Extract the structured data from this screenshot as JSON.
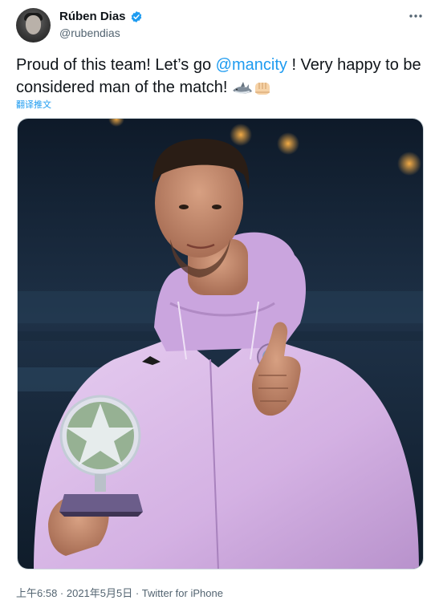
{
  "author": {
    "display_name": "Rúben Dias",
    "handle": "@rubendias",
    "verified": true
  },
  "tweet": {
    "text_part1": "Proud of this team! Let’s go ",
    "mention": "@mancity",
    "text_part2": " ! Very happy to be considered man of the match! ",
    "emojis": [
      "shark-emoji",
      "fist-bump-emoji"
    ],
    "translate_label": "翻译推文",
    "media_icon": "photo-player-holding-trophy"
  },
  "meta": {
    "timestamp": "上午6:58 · 2021年5月5日 · Twitter for iPhone"
  },
  "colors": {
    "link": "#1d9bf0",
    "secondary_text": "#536471",
    "jacket": "#d8b6e6"
  }
}
